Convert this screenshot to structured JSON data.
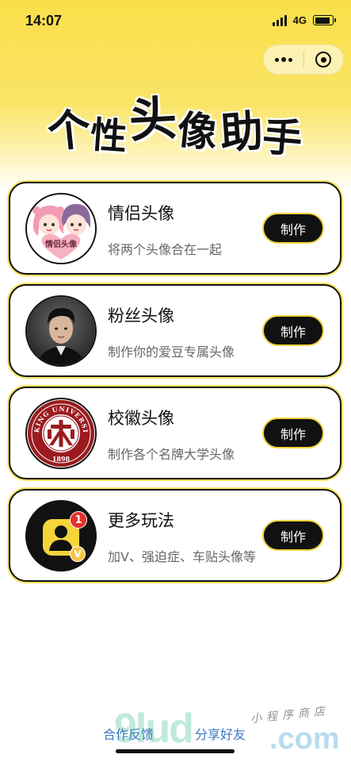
{
  "status_bar": {
    "time": "14:07",
    "network": "4G",
    "battery_level": 0.9
  },
  "capsule": {
    "more_icon": "more-dots-icon",
    "close_icon": "target-close-icon"
  },
  "header": {
    "title_chars": [
      "个",
      "性",
      "头",
      "像",
      "助",
      "手"
    ]
  },
  "cards": [
    {
      "title": "情侣头像",
      "desc": "将两个头像合在一起",
      "button": "制作",
      "avatar_badge": "情侣头像",
      "icon": "couple-avatar-icon"
    },
    {
      "title": "粉丝头像",
      "desc": "制作你的爱豆专属头像",
      "button": "制作",
      "icon": "idol-photo-icon"
    },
    {
      "title": "校徽头像",
      "desc": "制作各个名牌大学头像",
      "button": "制作",
      "icon": "university-emblem-icon",
      "emblem_text": "PEKING UNIVERSITY",
      "emblem_year": "1898"
    },
    {
      "title": "更多玩法",
      "desc": "加V、强迫症、车贴头像等",
      "button": "制作",
      "icon": "user-badge-icon",
      "badge_count": "1",
      "badge_v": "V"
    }
  ],
  "footer": {
    "feedback": "合作反馈",
    "share": "分享好友"
  },
  "watermark": {
    "main": "9lud",
    "domain": ".com",
    "subtitle": "小程序商店"
  },
  "colors": {
    "accent_yellow": "#f9df4a",
    "link_blue": "#3b78c4",
    "badge_red": "#e5322d",
    "emblem_red": "#9b1b1f"
  }
}
